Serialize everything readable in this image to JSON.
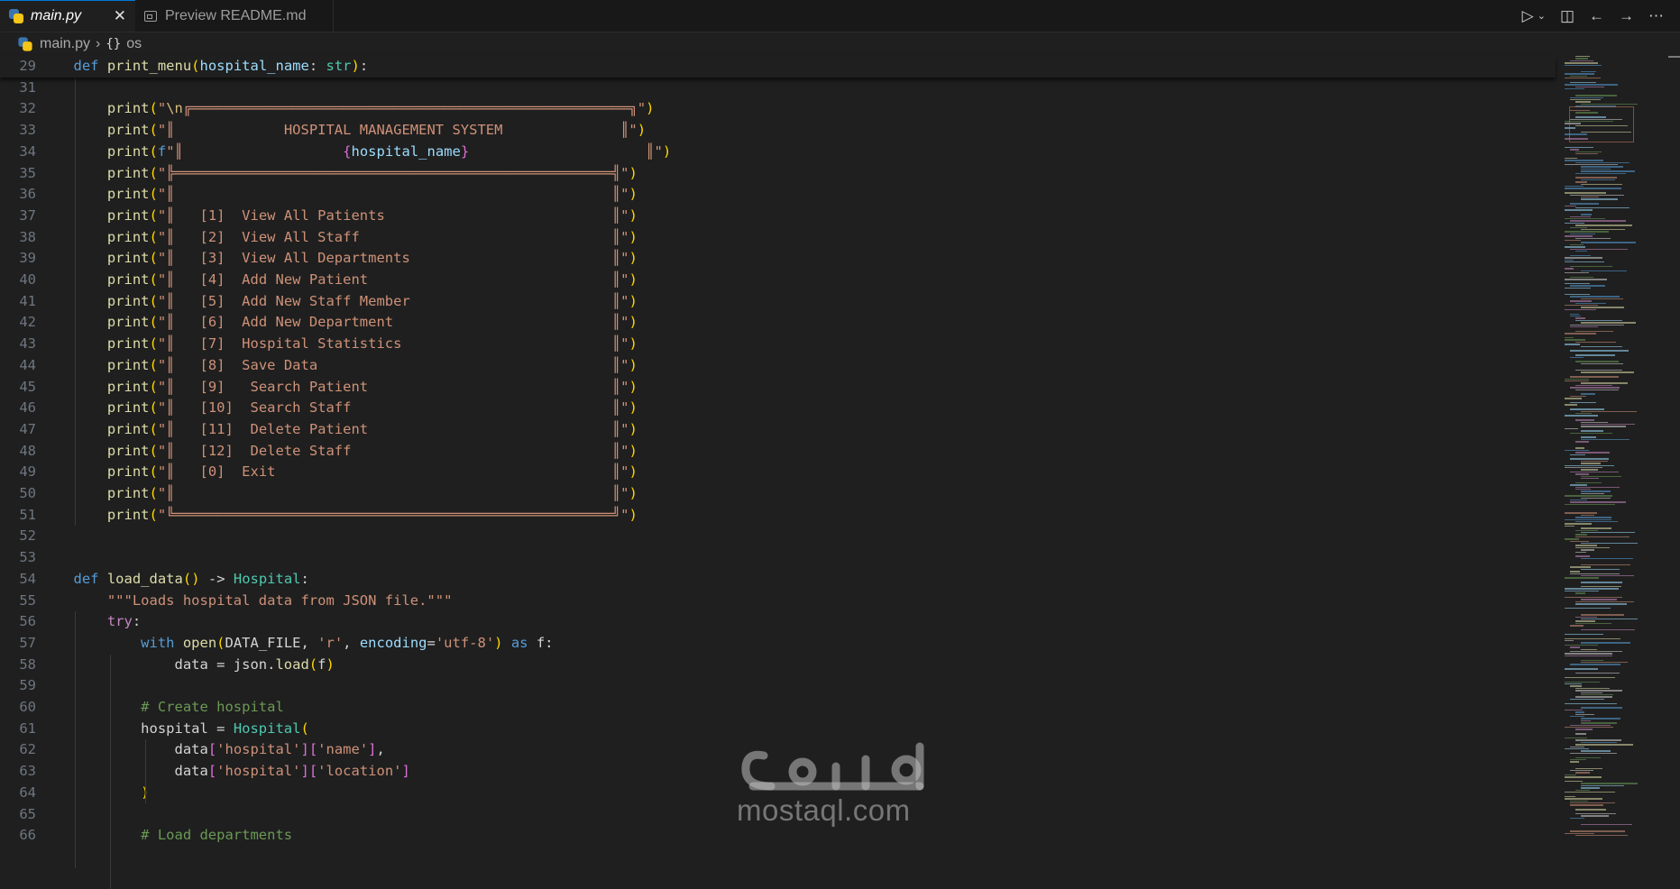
{
  "tabs": [
    {
      "label": "main.py",
      "active": true,
      "icon": "python-file-icon"
    },
    {
      "label": "Preview README.md",
      "active": false,
      "icon": "preview-icon"
    }
  ],
  "breadcrumb": {
    "file": "main.py",
    "symbol": "os"
  },
  "editor_actions": [
    "run-icon",
    "dropdown-chevron-icon",
    "split-editor-icon",
    "back-arrow-icon",
    "forward-arrow-icon",
    "more-actions-icon"
  ],
  "code_lines": [
    {
      "n": "29",
      "t": "def print_menu(hospital_name: str):"
    },
    {
      "n": "31",
      "t": ""
    },
    {
      "n": "32",
      "t": "    print(\"\\n╔════════════════════════════════════════════════════╗\")"
    },
    {
      "n": "33",
      "t": "    print(\"║             HOSPITAL MANAGEMENT SYSTEM              ║\")"
    },
    {
      "n": "34",
      "t": "    print(f\"║                   {hospital_name}                     ║\")"
    },
    {
      "n": "35",
      "t": "    print(\"╠════════════════════════════════════════════════════╣\")"
    },
    {
      "n": "36",
      "t": "    print(\"║                                                    ║\")"
    },
    {
      "n": "37",
      "t": "    print(\"║   [1]  View All Patients                           ║\")"
    },
    {
      "n": "38",
      "t": "    print(\"║   [2]  View All Staff                              ║\")"
    },
    {
      "n": "39",
      "t": "    print(\"║   [3]  View All Departments                        ║\")"
    },
    {
      "n": "40",
      "t": "    print(\"║   [4]  Add New Patient                             ║\")"
    },
    {
      "n": "41",
      "t": "    print(\"║   [5]  Add New Staff Member                        ║\")"
    },
    {
      "n": "42",
      "t": "    print(\"║   [6]  Add New Department                          ║\")"
    },
    {
      "n": "43",
      "t": "    print(\"║   [7]  Hospital Statistics                         ║\")"
    },
    {
      "n": "44",
      "t": "    print(\"║   [8]  Save Data                                   ║\")"
    },
    {
      "n": "45",
      "t": "    print(\"║   [9]   Search Patient                             ║\")"
    },
    {
      "n": "46",
      "t": "    print(\"║   [10]  Search Staff                               ║\")"
    },
    {
      "n": "47",
      "t": "    print(\"║   [11]  Delete Patient                             ║\")"
    },
    {
      "n": "48",
      "t": "    print(\"║   [12]  Delete Staff                               ║\")"
    },
    {
      "n": "49",
      "t": "    print(\"║   [0]  Exit                                        ║\")"
    },
    {
      "n": "50",
      "t": "    print(\"║                                                    ║\")"
    },
    {
      "n": "51",
      "t": "    print(\"╚════════════════════════════════════════════════════╝\")"
    },
    {
      "n": "52",
      "t": ""
    },
    {
      "n": "53",
      "t": ""
    },
    {
      "n": "54",
      "t": "def load_data() -> Hospital:"
    },
    {
      "n": "55",
      "t": "    \"\"\"Loads hospital data from JSON file.\"\"\""
    },
    {
      "n": "56",
      "t": "    try:"
    },
    {
      "n": "57",
      "t": "        with open(DATA_FILE, 'r', encoding='utf-8') as f:"
    },
    {
      "n": "58",
      "t": "            data = json.load(f)"
    },
    {
      "n": "59",
      "t": ""
    },
    {
      "n": "60",
      "t": "        # Create hospital"
    },
    {
      "n": "61",
      "t": "        hospital = Hospital("
    },
    {
      "n": "62",
      "t": "            data['hospital']['name'],"
    },
    {
      "n": "63",
      "t": "            data['hospital']['location']"
    },
    {
      "n": "64",
      "t": "        )"
    },
    {
      "n": "65",
      "t": ""
    },
    {
      "n": "66",
      "t": "        # Load departments"
    }
  ],
  "watermark": {
    "arabic": "مستقل",
    "text": "mostaql.com"
  }
}
